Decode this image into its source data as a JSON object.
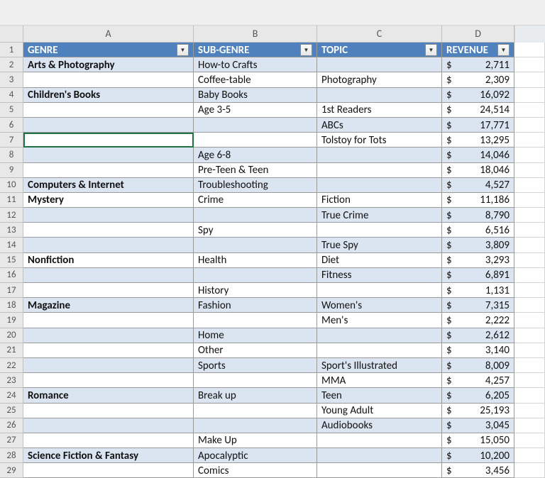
{
  "columns": [
    "A",
    "B",
    "C",
    "D"
  ],
  "col_widths": {
    "A": 240,
    "B": 174,
    "C": 176,
    "D": 102
  },
  "header_row": {
    "genre": "GENRE",
    "subgenre": "SUB-GENRE",
    "topic": "TOPIC",
    "revenue": "REVENUE"
  },
  "currency_symbol": "$",
  "rows": [
    {
      "n": 2,
      "genre": "Arts & Photography",
      "sub": "How-to Crafts",
      "topic": "",
      "rev": "2,711",
      "band": "even"
    },
    {
      "n": 3,
      "genre": "",
      "sub": "Coffee-table",
      "topic": "Photography",
      "rev": "2,309",
      "band": "odd"
    },
    {
      "n": 4,
      "genre": "Children's Books",
      "sub": "Baby Books",
      "topic": "",
      "rev": "16,092",
      "band": "even"
    },
    {
      "n": 5,
      "genre": "",
      "sub": "Age 3-5",
      "topic": "1st Readers",
      "rev": "24,514",
      "band": "odd"
    },
    {
      "n": 6,
      "genre": "",
      "sub": "",
      "topic": "ABCs",
      "rev": "17,771",
      "band": "even"
    },
    {
      "n": 7,
      "genre": "",
      "sub": "",
      "topic": "Tolstoy for Tots",
      "rev": "13,295",
      "band": "odd",
      "selected": true
    },
    {
      "n": 8,
      "genre": "",
      "sub": "Age 6-8",
      "topic": "",
      "rev": "14,046",
      "band": "even"
    },
    {
      "n": 9,
      "genre": "",
      "sub": "Pre-Teen & Teen",
      "topic": "",
      "rev": "18,046",
      "band": "odd"
    },
    {
      "n": 10,
      "genre": "Computers & Internet",
      "sub": "Troubleshooting",
      "topic": "",
      "rev": "4,527",
      "band": "even"
    },
    {
      "n": 11,
      "genre": "Mystery",
      "sub": "Crime",
      "topic": "Fiction",
      "rev": "11,186",
      "band": "odd"
    },
    {
      "n": 12,
      "genre": "",
      "sub": "",
      "topic": "True Crime",
      "rev": "8,790",
      "band": "even"
    },
    {
      "n": 13,
      "genre": "",
      "sub": "Spy",
      "topic": "",
      "rev": "6,516",
      "band": "odd"
    },
    {
      "n": 14,
      "genre": "",
      "sub": "",
      "topic": "True Spy",
      "rev": "3,809",
      "band": "even"
    },
    {
      "n": 15,
      "genre": "Nonfiction",
      "sub": "Health",
      "topic": "Diet",
      "rev": "3,293",
      "band": "odd"
    },
    {
      "n": 16,
      "genre": "",
      "sub": "",
      "topic": "Fitness",
      "rev": "6,891",
      "band": "even"
    },
    {
      "n": 17,
      "genre": "",
      "sub": "History",
      "topic": "",
      "rev": "1,131",
      "band": "odd"
    },
    {
      "n": 18,
      "genre": "Magazine",
      "sub": "Fashion",
      "topic": "Women's",
      "rev": "7,315",
      "band": "even"
    },
    {
      "n": 19,
      "genre": "",
      "sub": "",
      "topic": "Men's",
      "rev": "2,222",
      "band": "odd"
    },
    {
      "n": 20,
      "genre": "",
      "sub": "Home",
      "topic": "",
      "rev": "2,612",
      "band": "even"
    },
    {
      "n": 21,
      "genre": "",
      "sub": "Other",
      "topic": "",
      "rev": "3,140",
      "band": "odd"
    },
    {
      "n": 22,
      "genre": "",
      "sub": "Sports",
      "topic": "Sport's Illustrated",
      "rev": "8,009",
      "band": "even"
    },
    {
      "n": 23,
      "genre": "",
      "sub": "",
      "topic": "MMA",
      "rev": "4,257",
      "band": "odd"
    },
    {
      "n": 24,
      "genre": "Romance",
      "sub": "Break up",
      "topic": "Teen",
      "rev": "6,205",
      "band": "even"
    },
    {
      "n": 25,
      "genre": "",
      "sub": "",
      "topic": "Young Adult",
      "rev": "25,193",
      "band": "odd"
    },
    {
      "n": 26,
      "genre": "",
      "sub": "",
      "topic": "Audiobooks",
      "rev": "3,045",
      "band": "even"
    },
    {
      "n": 27,
      "genre": "",
      "sub": "Make Up",
      "topic": "",
      "rev": "15,050",
      "band": "odd"
    },
    {
      "n": 28,
      "genre": "Science Fiction & Fantasy",
      "sub": "Apocalyptic",
      "topic": "",
      "rev": "10,200",
      "band": "even"
    },
    {
      "n": 29,
      "genre": "",
      "sub": "Comics",
      "topic": "",
      "rev": "3,456",
      "band": "odd"
    }
  ]
}
